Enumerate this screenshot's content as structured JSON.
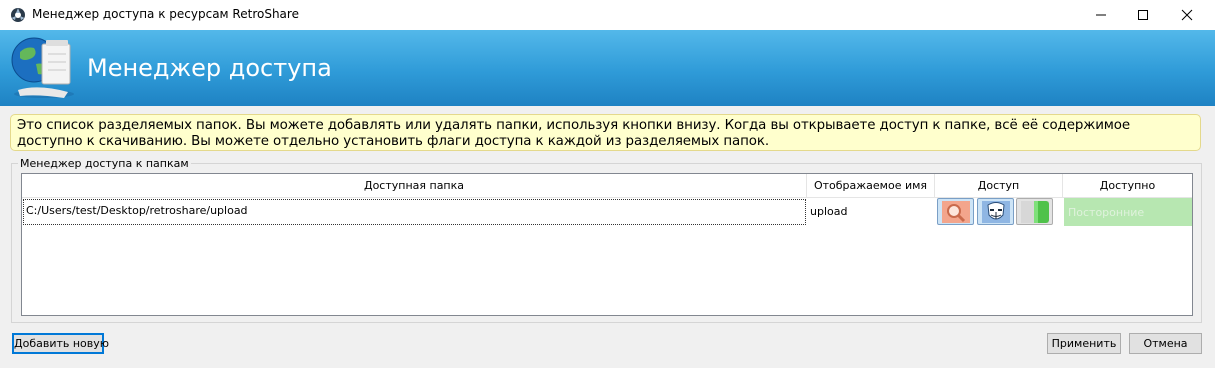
{
  "window": {
    "title": "Менеджер доступа к ресурсам RetroShare",
    "controls": {
      "minimize": "—",
      "maximize": "☐",
      "close": "✕"
    }
  },
  "header": {
    "title": "Менеджер доступа",
    "icon": "globe-folder-icon"
  },
  "info": {
    "text": "Это список разделяемых папок. Вы можете добавлять или удалять папки, используя кнопки внизу. Когда вы открываете доступ к папке, всё её содержимое доступно к скачиванию. Вы можете отдельно установить флаги доступа к каждой из разделяемых папок."
  },
  "group": {
    "legend": "Менеджер доступа к папкам"
  },
  "table": {
    "columns": [
      "Доступная папка",
      "Отображаемое имя",
      "Доступ",
      "Доступно"
    ],
    "rows": [
      {
        "path": "C:/Users/test/Desktop/retroshare/upload",
        "name": "upload",
        "flags": [
          "browsable-icon",
          "anonymous-icon",
          "download-icon"
        ],
        "groups": "Посторонние"
      }
    ]
  },
  "buttons": {
    "add": "Добавить новую",
    "apply": "Применить",
    "cancel": "Отмена"
  },
  "colors": {
    "header_top": "#53b8ea",
    "header_bottom": "#1e82c3",
    "info_bg": "#ffffcd",
    "groups_bg": "#b7e7b1"
  }
}
